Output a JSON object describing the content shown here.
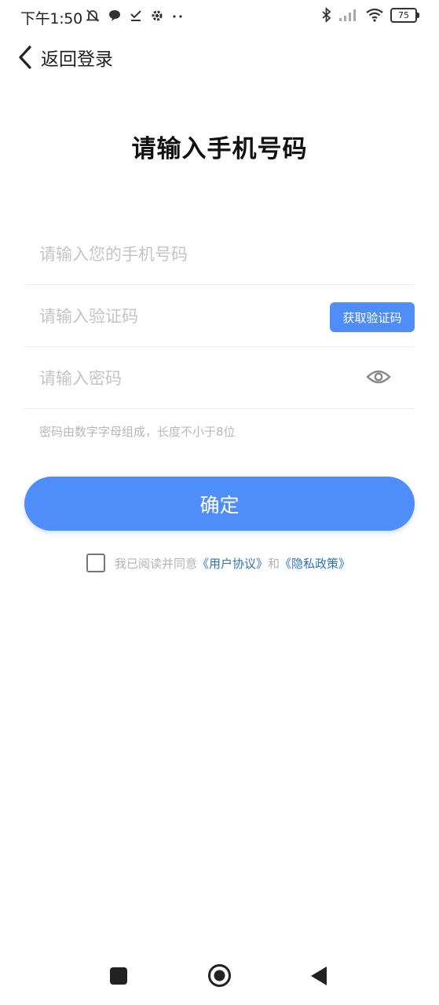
{
  "status_bar": {
    "time": "下午1:50",
    "battery": "75",
    "left_icons": [
      "muted-bell-icon",
      "chat-bubble-icon",
      "check-icon",
      "settings-gear-icon",
      "more-dots-icon"
    ],
    "right_icons": [
      "bluetooth-icon",
      "signal-icon",
      "wifi-icon",
      "battery-icon"
    ]
  },
  "header": {
    "back_label": "返回登录",
    "title": "请输入手机号码"
  },
  "form": {
    "phone_placeholder": "请输入您的手机号码",
    "code_placeholder": "请输入验证码",
    "get_code_label": "获取验证码",
    "password_placeholder": "请输入密码",
    "password_hint": "密码由数字字母组成，长度不小于8位",
    "confirm_label": "确定"
  },
  "agreement": {
    "prefix": "我已阅读并同意",
    "user_agreement": "《用户协议》",
    "and": "和",
    "privacy_policy": "《隐私政策》"
  },
  "colors": {
    "accent": "#4f8df8",
    "link": "#2c74b9",
    "placeholder": "#c4c4c4"
  }
}
